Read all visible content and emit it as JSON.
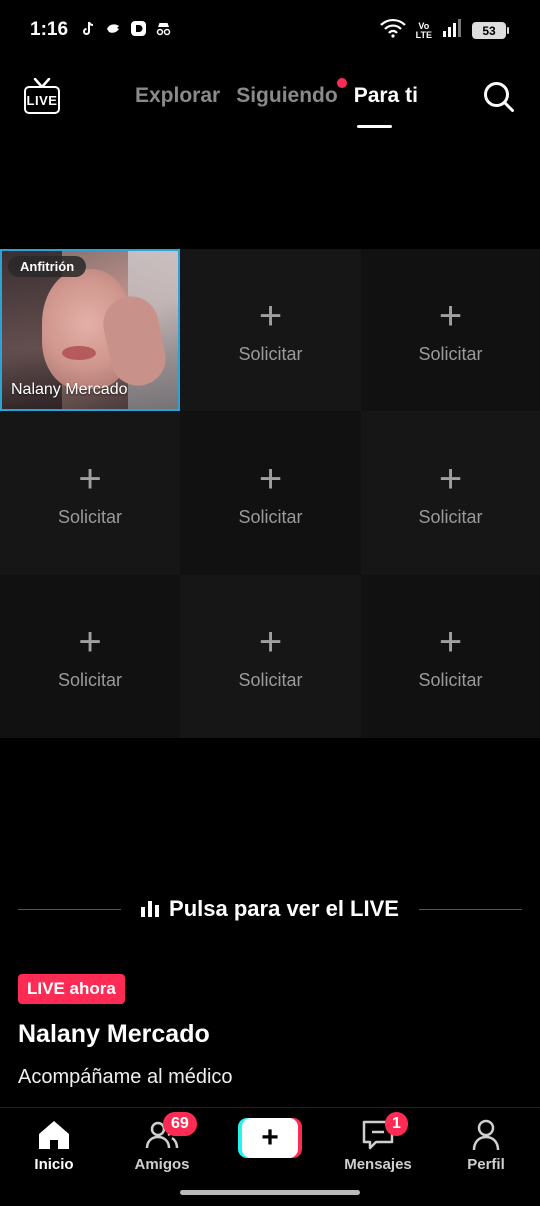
{
  "status_bar": {
    "time": "1:16",
    "network": "Vo\nLTE",
    "battery": "53"
  },
  "top_nav": {
    "tabs": [
      {
        "label": "Explorar"
      },
      {
        "label": "Siguiendo"
      },
      {
        "label": "Para ti"
      }
    ]
  },
  "grid": {
    "host": {
      "badge": "Anfitrión",
      "name": "Nalany Mercado"
    },
    "slot_label": "Solicitar",
    "slot_icon": "+"
  },
  "live_prompt": {
    "text": "Pulsa para ver el LIVE"
  },
  "stream": {
    "badge": "LIVE ahora",
    "name": "Nalany Mercado",
    "description": "Acompáñame al médico"
  },
  "bottom_nav": {
    "items": [
      {
        "label": "Inicio"
      },
      {
        "label": "Amigos",
        "badge": "69"
      },
      {
        "label": ""
      },
      {
        "label": "Mensajes",
        "badge": "1"
      },
      {
        "label": "Perfil"
      }
    ],
    "create_icon": "+"
  },
  "colors": {
    "accent": "#fe2c55",
    "cyan": "#25f4ee",
    "host_border": "#2ba3d6"
  }
}
